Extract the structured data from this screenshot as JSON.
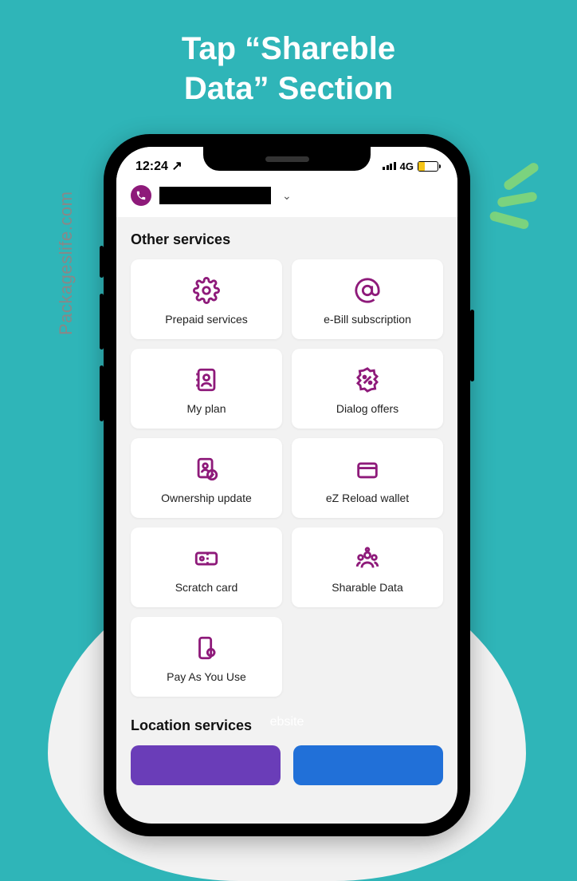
{
  "heading_line1": "Tap “Shareble",
  "heading_line2": "Data” Section",
  "watermark": "Packageslife.com",
  "status": {
    "time": "12:24 ↗",
    "network": "4G"
  },
  "header": {
    "account_placeholder": "Account dropdown"
  },
  "sections": {
    "other_services": "Other services",
    "location_services": "Location services"
  },
  "services": [
    {
      "id": "prepaid-services",
      "label": "Prepaid services",
      "icon": "gear"
    },
    {
      "id": "ebill-subscription",
      "label": "e-Bill subscription",
      "icon": "at"
    },
    {
      "id": "my-plan",
      "label": "My plan",
      "icon": "contactbook"
    },
    {
      "id": "dialog-offers",
      "label": "Dialog offers",
      "icon": "percent"
    },
    {
      "id": "ownership-update",
      "label": "Ownership update",
      "icon": "idcheck"
    },
    {
      "id": "ez-reload-wallet",
      "label": "eZ Reload wallet",
      "icon": "wallet"
    },
    {
      "id": "scratch-card",
      "label": "Scratch card",
      "icon": "ticket"
    },
    {
      "id": "sharable-data",
      "label": "Sharable Data",
      "icon": "group"
    },
    {
      "id": "pay-as-you-use",
      "label": "Pay As You Use",
      "icon": "phonegear"
    }
  ],
  "website_hint": "ebsite"
}
